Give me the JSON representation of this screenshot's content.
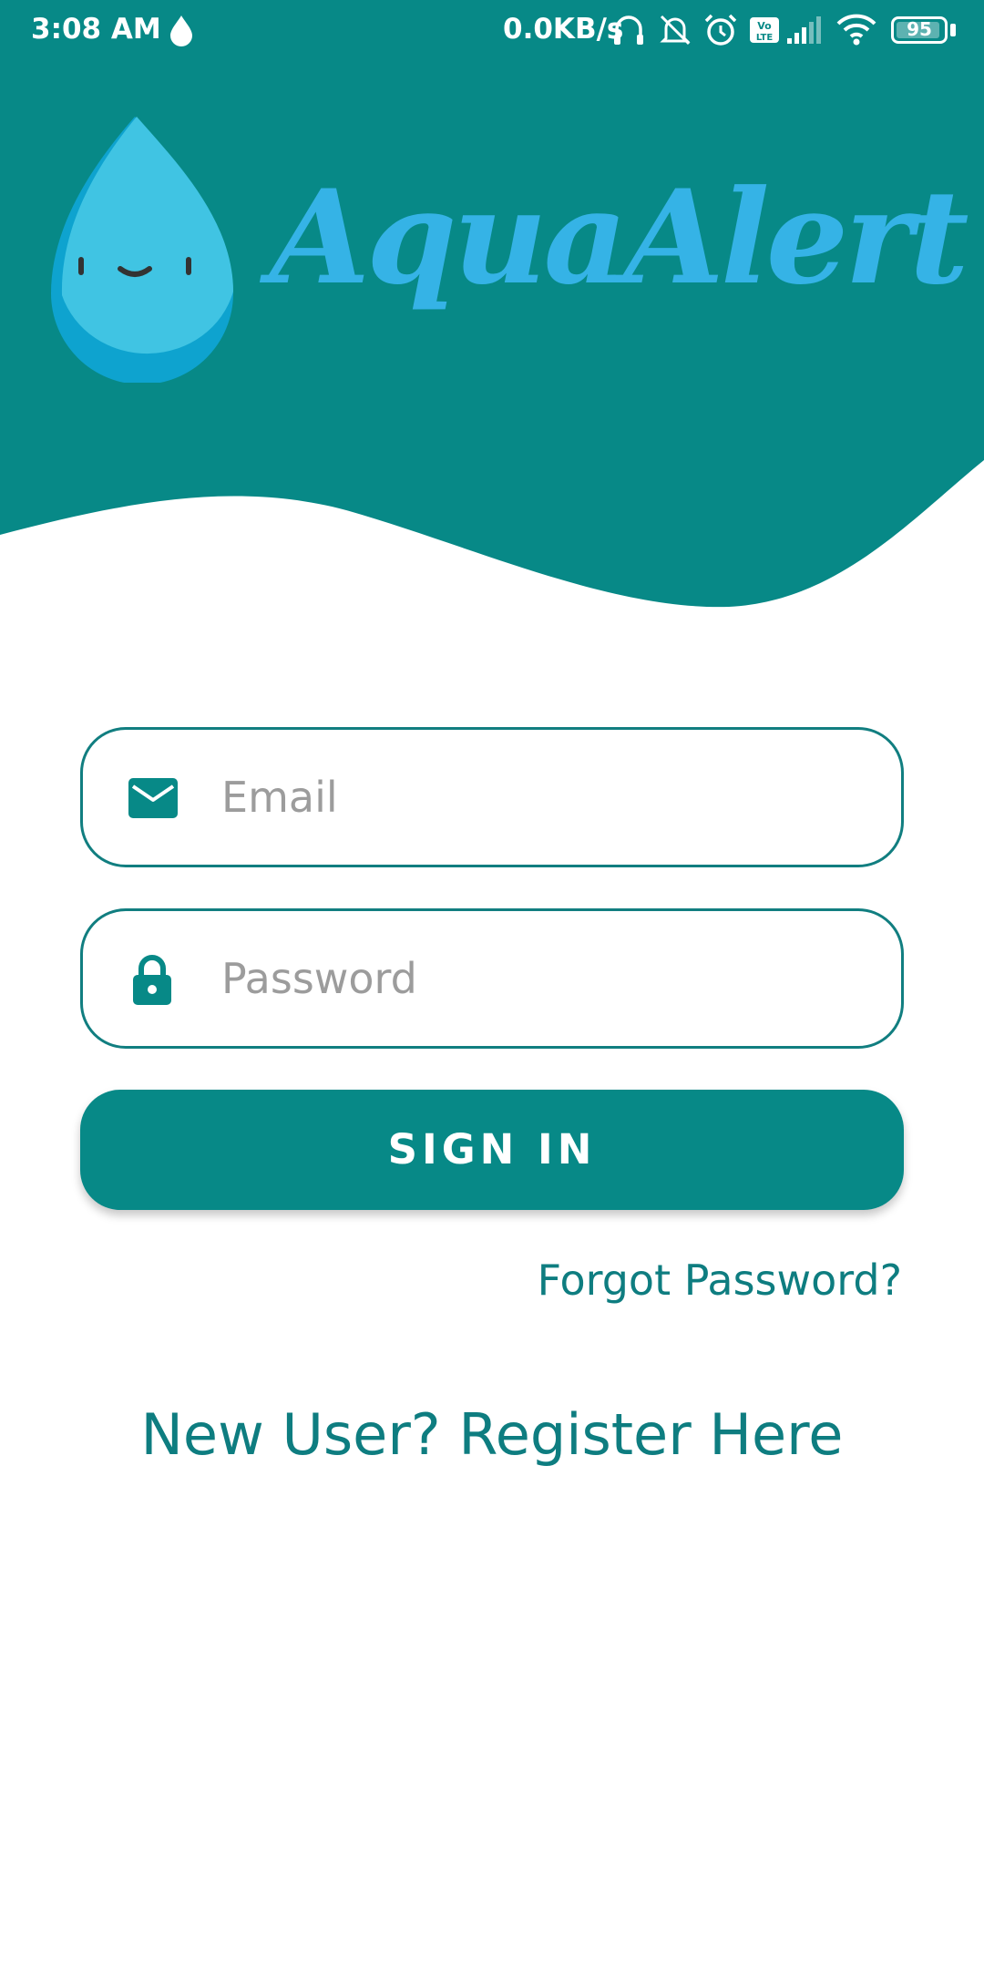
{
  "colors": {
    "primary": "#078987",
    "logo_blue": "#35b3e6",
    "link": "#0e7d80",
    "background": "#ffffff"
  },
  "status_bar": {
    "time": "3:08 AM",
    "network_speed": "0.0KB/s",
    "battery": "95",
    "icons": [
      "water-drop-icon",
      "headset-icon",
      "mute-icon",
      "alarm-icon",
      "volte-icon",
      "signal-icon",
      "wifi-icon",
      "battery-icon"
    ]
  },
  "header": {
    "app_name": "AquaAlert",
    "logo_icon": "water-drop-face-icon"
  },
  "login": {
    "email_placeholder": "Email",
    "email_icon": "mail-icon",
    "password_placeholder": "Password",
    "password_icon": "lock-icon",
    "sign_in_label": "SIGN IN",
    "forgot_password_label": "Forgot Password?",
    "register_label": "New User? Register Here"
  }
}
